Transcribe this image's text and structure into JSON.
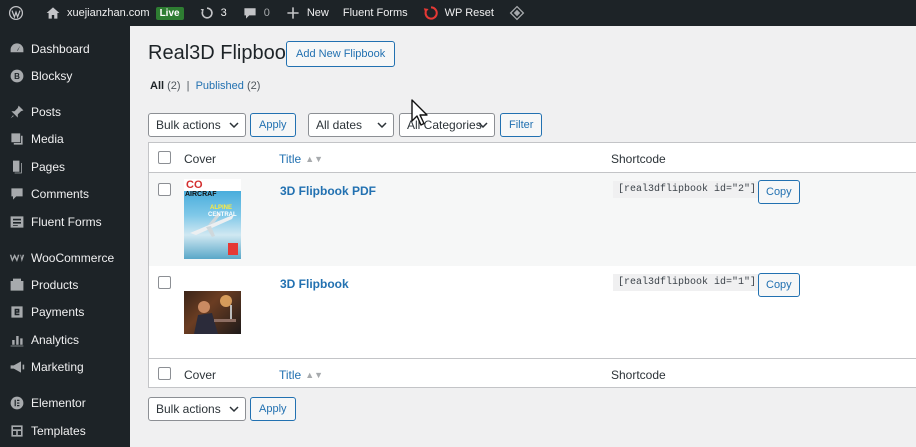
{
  "adminbar": {
    "site_name": "xuejianzhan.com",
    "live_badge": "Live",
    "updates_count": "3",
    "comments_count": "0",
    "new_label": "New",
    "fluent_forms": "Fluent Forms",
    "wp_reset": "WP Reset"
  },
  "sidebar": {
    "items": [
      {
        "label": "Dashboard",
        "icon": "dashboard-icon"
      },
      {
        "label": "Blocksy",
        "icon": "blocksy-icon"
      },
      {
        "label": "Posts",
        "icon": "pin-icon"
      },
      {
        "label": "Media",
        "icon": "media-icon"
      },
      {
        "label": "Pages",
        "icon": "pages-icon"
      },
      {
        "label": "Comments",
        "icon": "comments-icon"
      },
      {
        "label": "Fluent Forms",
        "icon": "forms-icon"
      },
      {
        "label": "WooCommerce",
        "icon": "woo-icon"
      },
      {
        "label": "Products",
        "icon": "products-icon"
      },
      {
        "label": "Payments",
        "icon": "payments-icon"
      },
      {
        "label": "Analytics",
        "icon": "analytics-icon"
      },
      {
        "label": "Marketing",
        "icon": "marketing-icon"
      },
      {
        "label": "Elementor",
        "icon": "elementor-icon"
      },
      {
        "label": "Templates",
        "icon": "templates-icon"
      }
    ]
  },
  "main": {
    "page_title": "Real3D Flipbook",
    "add_new_label": "Add New Flipbook",
    "filters": {
      "all_label": "All",
      "all_count": "(2)",
      "separator": "|",
      "published_label": "Published",
      "published_count": "(2)"
    },
    "toolbar_top": {
      "bulk_actions": "Bulk actions",
      "apply": "Apply",
      "dates": "All dates",
      "categories": "All Categories",
      "filter": "Filter"
    },
    "toolbar_bottom": {
      "bulk_actions": "Bulk actions",
      "apply": "Apply"
    },
    "table": {
      "columns": {
        "cover": "Cover",
        "title": "Title",
        "shortcode": "Shortcode"
      },
      "rows": [
        {
          "title": "3D Flipbook PDF",
          "shortcode": "[real3dflipbook id=\"2\"]",
          "copy_label": "Copy",
          "cover_text_1": "CO",
          "cover_text_2": "AIRCRAF",
          "cover_text_3": "ALPINE",
          "cover_text_4": "CENTRAL"
        },
        {
          "title": "3D Flipbook",
          "shortcode": "[real3dflipbook id=\"1\"]",
          "copy_label": "Copy"
        }
      ]
    }
  },
  "colors": {
    "admin_dark": "#1d2327",
    "link_blue": "#2271b1",
    "live_green": "#2e7d32",
    "background": "#f0f0f1"
  }
}
